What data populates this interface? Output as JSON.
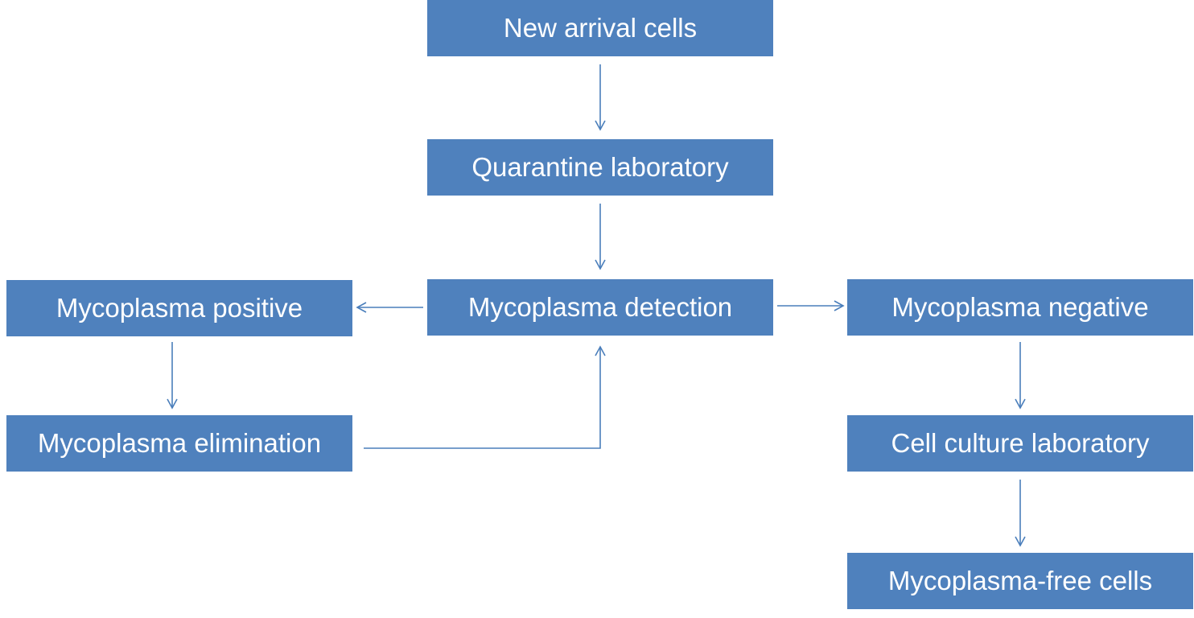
{
  "colors": {
    "box_fill": "#4F81BD",
    "text": "#FFFFFF",
    "arrow": "#4A7EBB"
  },
  "nodes": {
    "new_arrival": "New arrival cells",
    "quarantine": "Quarantine laboratory",
    "detection": "Mycoplasma detection",
    "positive": "Mycoplasma positive",
    "negative": "Mycoplasma negative",
    "elimination": "Mycoplasma elimination",
    "culture_lab": "Cell culture laboratory",
    "free_cells": "Mycoplasma-free cells"
  },
  "edges": [
    {
      "from": "new_arrival",
      "to": "quarantine"
    },
    {
      "from": "quarantine",
      "to": "detection"
    },
    {
      "from": "detection",
      "to": "positive"
    },
    {
      "from": "detection",
      "to": "negative"
    },
    {
      "from": "positive",
      "to": "elimination"
    },
    {
      "from": "elimination",
      "to": "detection"
    },
    {
      "from": "negative",
      "to": "culture_lab"
    },
    {
      "from": "culture_lab",
      "to": "free_cells"
    }
  ]
}
